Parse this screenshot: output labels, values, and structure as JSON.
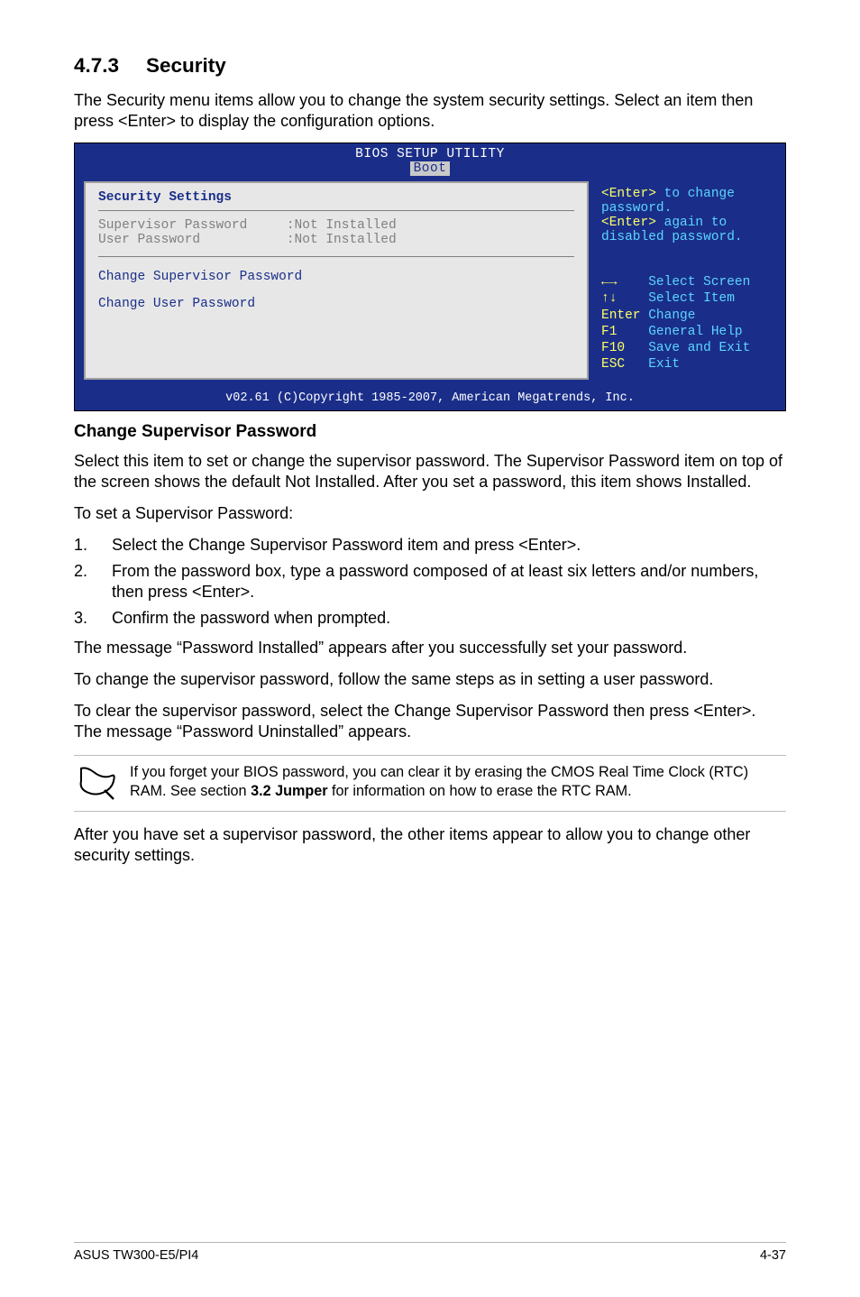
{
  "section": {
    "number": "4.7.3",
    "title": "Security"
  },
  "intro": "The Security menu items allow you to change the system security settings. Select an item then press <Enter> to display the configuration options.",
  "bios": {
    "title": "BIOS SETUP UTILITY",
    "tab": "Boot",
    "left": {
      "header": "Security Settings",
      "rows": [
        {
          "label": "Supervisor Password",
          "value": ":Not Installed"
        },
        {
          "label": "User Password",
          "value": ":Not Installed"
        }
      ],
      "change": [
        "Change Supervisor Password",
        "Change User Password"
      ]
    },
    "right": {
      "help": [
        {
          "pre": "<Enter>",
          "post": " to change"
        },
        {
          "pre": "",
          "post": "password."
        },
        {
          "pre": "<Enter>",
          "post": " again to"
        },
        {
          "pre": "",
          "post": "disabled password."
        }
      ],
      "hotkeys": [
        {
          "k": "lr",
          "v": "Select Screen"
        },
        {
          "k": "ud",
          "v": "Select Item"
        },
        {
          "k": "Enter",
          "v": "Change"
        },
        {
          "k": "F1",
          "v": "General Help"
        },
        {
          "k": "F10",
          "v": "Save and Exit"
        },
        {
          "k": "ESC",
          "v": "Exit"
        }
      ]
    },
    "copyright": "v02.61 (C)Copyright 1985-2007, American Megatrends, Inc."
  },
  "subhead": "Change Supervisor Password",
  "para1": "Select this item to set or change the supervisor password. The Supervisor Password item on top of the screen shows the default Not Installed. After you set a password, this item shows Installed.",
  "para2": "To set a Supervisor Password:",
  "steps": [
    "Select the Change Supervisor Password item and press <Enter>.",
    "From the password box, type a password composed of at least six letters and/or numbers, then press <Enter>.",
    "Confirm the password when prompted."
  ],
  "para3": "The message “Password Installed” appears after you successfully set your password.",
  "para4": "To change the supervisor password, follow the same steps as in setting a user password.",
  "para5": "To clear the supervisor password, select the Change Supervisor Password then press <Enter>. The message “Password Uninstalled” appears.",
  "note_pre": "If you forget your BIOS password, you can clear it by erasing the CMOS Real Time Clock (RTC) RAM. See section ",
  "note_bold": "3.2 Jumper",
  "note_post": " for information on how to erase the RTC RAM.",
  "para6": "After you have set a supervisor password, the other items appear to allow you to change other security settings.",
  "footer": {
    "left": "ASUS TW300-E5/PI4",
    "right": "4-37"
  }
}
